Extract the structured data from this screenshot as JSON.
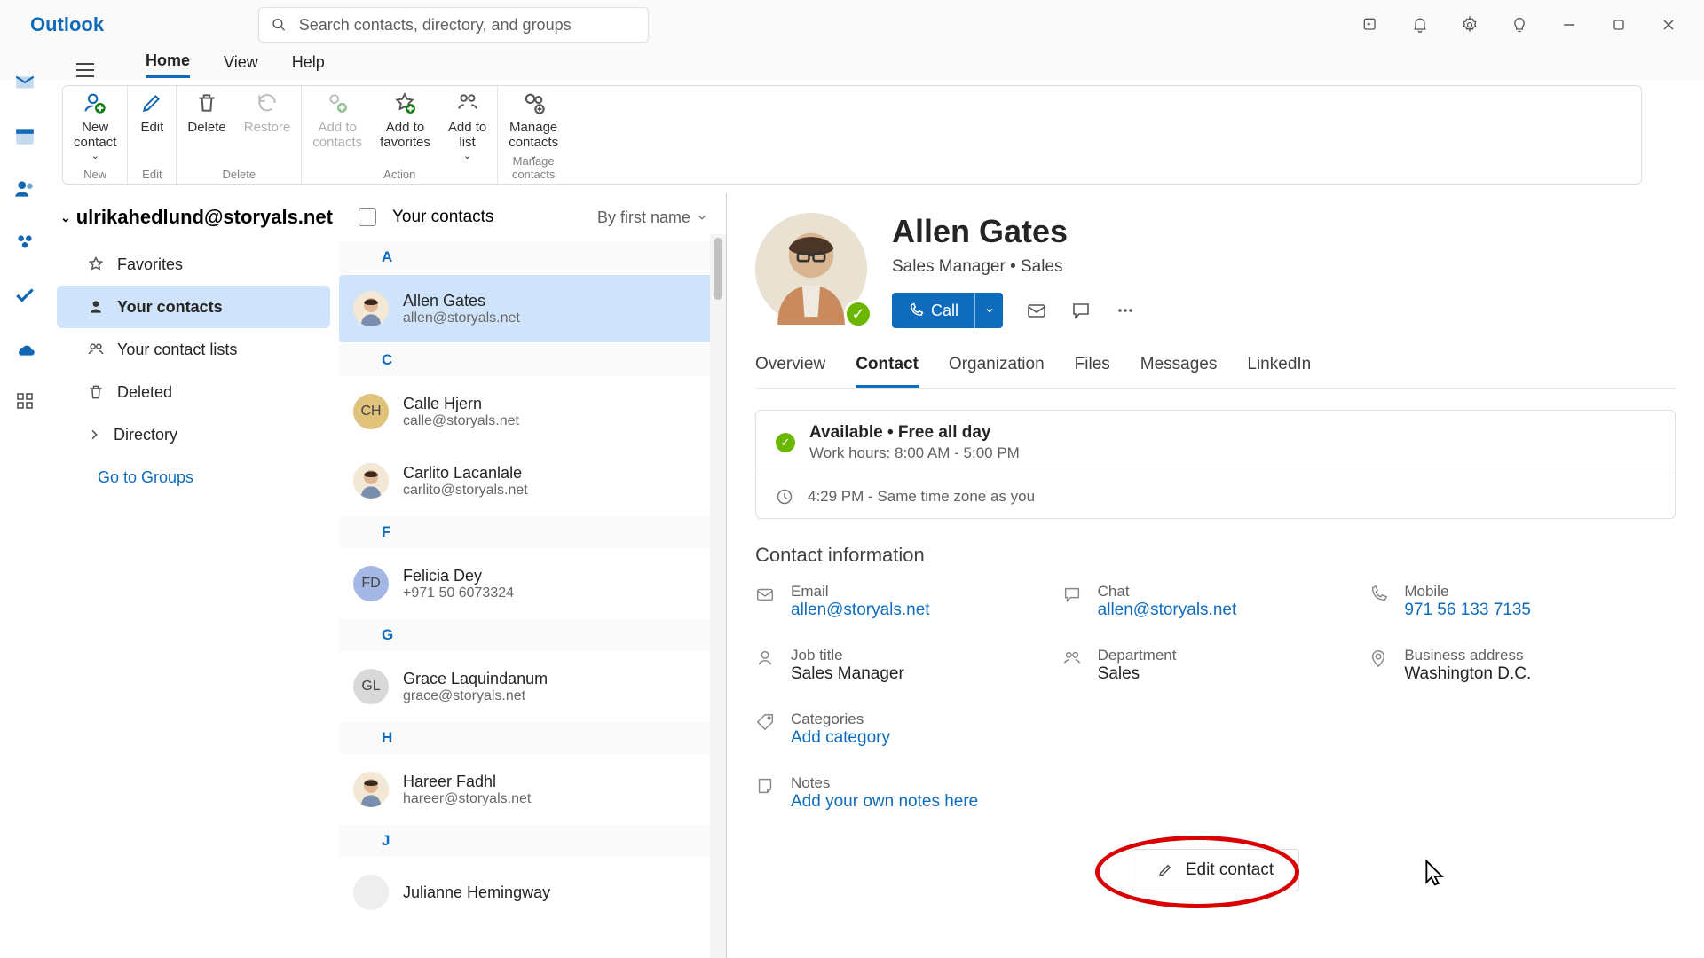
{
  "titlebar": {
    "brand": "Outlook",
    "search_placeholder": "Search contacts, directory, and groups"
  },
  "menubar": {
    "home": "Home",
    "view": "View",
    "help": "Help"
  },
  "ribbon": {
    "new_contact": "New\ncontact",
    "edit": "Edit",
    "delete": "Delete",
    "restore": "Restore",
    "add_to_contacts": "Add to\ncontacts",
    "add_to_favorites": "Add to\nfavorites",
    "add_to_list": "Add to\nlist",
    "manage_contacts": "Manage\ncontacts",
    "grp_new": "New",
    "grp_edit": "Edit",
    "grp_delete": "Delete",
    "grp_action": "Action",
    "grp_manage": "Manage contacts"
  },
  "sidebar": {
    "account": "ulrikahedlund@storyals.net",
    "favorites": "Favorites",
    "your_contacts": "Your contacts",
    "your_lists": "Your contact lists",
    "deleted": "Deleted",
    "directory": "Directory",
    "groups": "Go to Groups"
  },
  "list": {
    "header": "Your contacts",
    "sort": "By first name",
    "groups": [
      {
        "letter": "A",
        "items": [
          {
            "name": "Allen Gates",
            "sub": "allen@storyals.net",
            "kind": "img",
            "avatar": "",
            "selected": true
          }
        ]
      },
      {
        "letter": "C",
        "items": [
          {
            "name": "Calle Hjern",
            "sub": "calle@storyals.net",
            "kind": "init",
            "avatar": "CH",
            "bg": "#e0c27a"
          },
          {
            "name": "Carlito Lacanlale",
            "sub": "carlito@storyals.net",
            "kind": "img",
            "avatar": ""
          }
        ]
      },
      {
        "letter": "F",
        "items": [
          {
            "name": "Felicia Dey",
            "sub": "+971 50 6073324",
            "kind": "init",
            "avatar": "FD",
            "bg": "#a5b7e4"
          }
        ]
      },
      {
        "letter": "G",
        "items": [
          {
            "name": "Grace Laquindanum",
            "sub": "grace@storyals.net",
            "kind": "init",
            "avatar": "GL",
            "bg": "#d9d9d9"
          }
        ]
      },
      {
        "letter": "H",
        "items": [
          {
            "name": "Hareer Fadhl",
            "sub": "hareer@storyals.net",
            "kind": "img",
            "avatar": ""
          }
        ]
      },
      {
        "letter": "J",
        "items": [
          {
            "name": "Julianne Hemingway",
            "sub": "",
            "kind": "init",
            "avatar": "",
            "bg": "#eee"
          }
        ]
      }
    ]
  },
  "profile": {
    "name": "Allen Gates",
    "title": "Sales Manager • Sales",
    "call": "Call",
    "tabs": {
      "overview": "Overview",
      "contact": "Contact",
      "organization": "Organization",
      "files": "Files",
      "messages": "Messages",
      "linkedin": "LinkedIn"
    },
    "status": {
      "line1": "Available • Free all day",
      "line2": "Work hours: 8:00 AM - 5:00 PM",
      "tz": "4:29 PM - Same time zone as you"
    },
    "section": "Contact information",
    "fields": {
      "email_l": "Email",
      "email_v": "allen@storyals.net",
      "chat_l": "Chat",
      "chat_v": "allen@storyals.net",
      "mobile_l": "Mobile",
      "mobile_v": "971 56 133 7135",
      "job_l": "Job title",
      "job_v": "Sales Manager",
      "dept_l": "Department",
      "dept_v": "Sales",
      "addr_l": "Business address",
      "addr_v": "Washington D.C.",
      "cat_l": "Categories",
      "cat_v": "Add category",
      "notes_l": "Notes",
      "notes_v": "Add your own notes here"
    },
    "edit": "Edit contact"
  }
}
